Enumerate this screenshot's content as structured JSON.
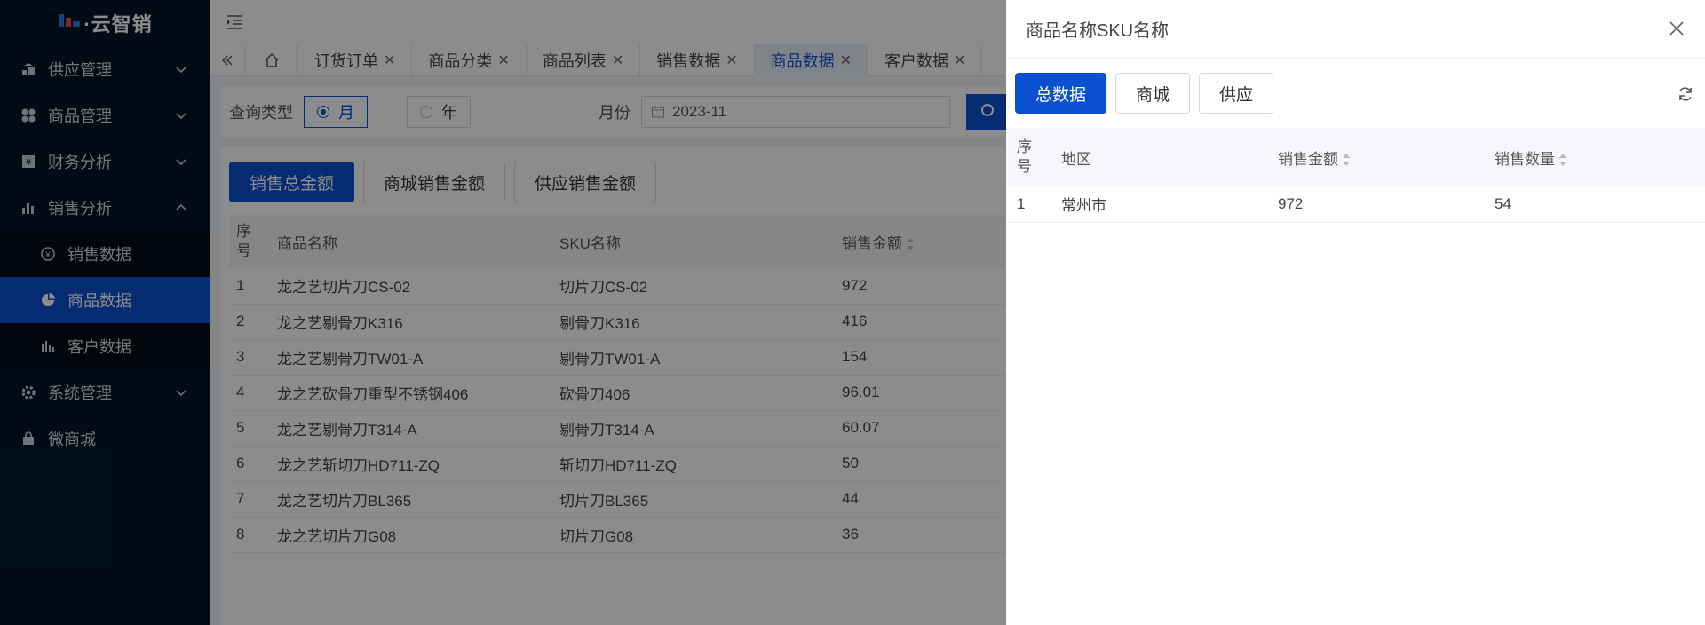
{
  "sidebar": {
    "logo_text": "·云智销",
    "menu": [
      {
        "label": "供应管理",
        "icon": "supply-icon"
      },
      {
        "label": "商品管理",
        "icon": "grid-icon"
      },
      {
        "label": "财务分析",
        "icon": "finance-icon"
      },
      {
        "label": "销售分析",
        "icon": "bar-chart-icon"
      }
    ],
    "sales_submenu": [
      {
        "label": "销售数据",
        "icon": "yen-circle-icon"
      },
      {
        "label": "商品数据",
        "icon": "pie-chart-icon",
        "active": true
      },
      {
        "label": "客户数据",
        "icon": "column-chart-icon"
      }
    ],
    "bottom_menu": [
      {
        "label": "系统管理",
        "icon": "gear-icon"
      },
      {
        "label": "微商城",
        "icon": "shop-bag-icon"
      }
    ]
  },
  "tabs": [
    {
      "label": "订货订单"
    },
    {
      "label": "商品分类"
    },
    {
      "label": "商品列表"
    },
    {
      "label": "销售数据"
    },
    {
      "label": "商品数据",
      "active": true
    },
    {
      "label": "客户数据"
    }
  ],
  "query": {
    "type_label": "查询类型",
    "month_label": "月",
    "year_label": "年",
    "period_label": "月份",
    "period_value": "2023-11"
  },
  "panel": {
    "buttons": [
      "销售总金额",
      "商城销售金额",
      "供应销售金额"
    ],
    "columns": [
      "序号",
      "商品名称",
      "SKU名称",
      "销售金额"
    ],
    "rows": [
      [
        "1",
        "龙之艺切片刀CS-02",
        "切片刀CS-02",
        "972"
      ],
      [
        "2",
        "龙之艺剔骨刀K316",
        "剔骨刀K316",
        "416"
      ],
      [
        "3",
        "龙之艺剔骨刀TW01-A",
        "剔骨刀TW01-A",
        "154"
      ],
      [
        "4",
        "龙之艺砍骨刀重型不锈钢406",
        "砍骨刀406",
        "96.01"
      ],
      [
        "5",
        "龙之艺剔骨刀T314-A",
        "剔骨刀T314-A",
        "60.07"
      ],
      [
        "6",
        "龙之艺斩切刀HD711-ZQ",
        "斩切刀HD711-ZQ",
        "50"
      ],
      [
        "7",
        "龙之艺切片刀BL365",
        "切片刀BL365",
        "44"
      ],
      [
        "8",
        "龙之艺切片刀G08",
        "切片刀G08",
        "36"
      ]
    ]
  },
  "drawer": {
    "title": "商品名称SKU名称",
    "buttons": [
      "总数据",
      "商城",
      "供应"
    ],
    "columns": [
      "序号",
      "地区",
      "销售金额",
      "销售数量"
    ],
    "rows": [
      [
        "1",
        "常州市",
        "972",
        "54"
      ]
    ]
  },
  "colors": {
    "primary": "#0a50d0",
    "sidebar_bg": "#001529",
    "submenu_bg": "#000c17"
  }
}
